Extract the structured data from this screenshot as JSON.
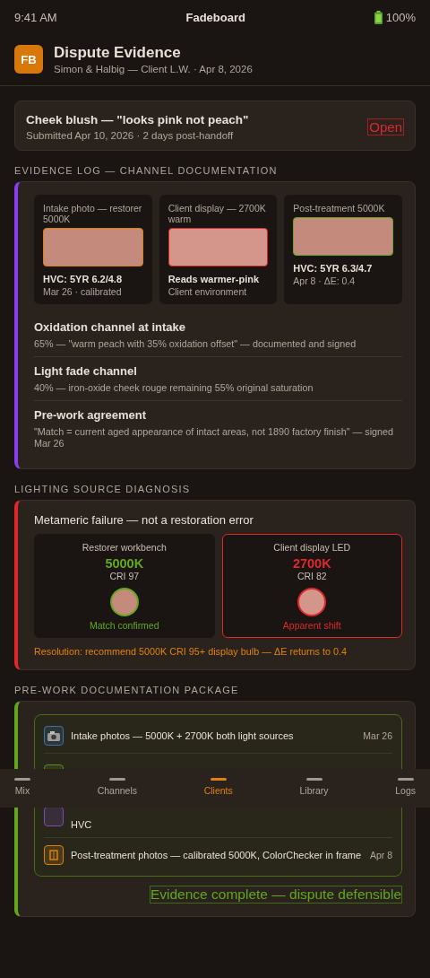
{
  "status_bar": {
    "time": "9:41 AM",
    "app": "Fadeboard",
    "battery": "100%"
  },
  "header": {
    "logo": "FB",
    "title": "Dispute Evidence",
    "subtitle": "Simon & Halbig — Client L.W. · Apr 8, 2026"
  },
  "dispute": {
    "title": "Cheek blush — \"looks pink not peach\"",
    "meta": "Submitted Apr 10, 2026 · 2 days post-handoff",
    "status": "Open"
  },
  "evidence": {
    "heading": "EVIDENCE LOG — CHANNEL DOCUMENTATION",
    "swatches": [
      {
        "label": "Intake photo — restorer 5000K",
        "color": "#c48a7c",
        "kind": "intake",
        "value": "HVC: 5YR 6.2/4.8",
        "note": "Mar 26 · calibrated"
      },
      {
        "label": "Client display — 2700K warm",
        "color": "#d4968a",
        "kind": "display",
        "value": "Reads warmer-pink",
        "note": "Client environment"
      },
      {
        "label": "Post-treatment 5000K",
        "color": "#c48a7c",
        "kind": "post",
        "value": "HVC: 5YR 6.3/4.7",
        "note": "Apr 8 · ΔE: 0.4"
      }
    ],
    "entries": [
      {
        "title": "Oxidation channel at intake",
        "text": "65% — \"warm peach with 35% oxidation offset\" — documented and signed"
      },
      {
        "title": "Light fade channel",
        "text": "40% — iron-oxide cheek rouge remaining 55% original saturation"
      },
      {
        "title": "Pre-work agreement",
        "text": "\"Match = current aged appearance of intact areas, not 1890 factory finish\" — signed Mar 26"
      }
    ]
  },
  "lighting": {
    "heading": "LIGHTING SOURCE DIAGNOSIS",
    "title": "Metameric failure — not a restoration error",
    "sources": [
      {
        "name": "Restorer workbench",
        "temp": "5000K",
        "cri": "CRI 97",
        "status": "Match confirmed",
        "kind": "ok",
        "color": "#c48a7c"
      },
      {
        "name": "Client display LED",
        "temp": "2700K",
        "cri": "CRI 82",
        "status": "Apparent shift",
        "kind": "fail",
        "color": "#d4968a"
      }
    ],
    "resolution": "Resolution: recommend 5000K CRI 95+ display bulb — ΔE returns to 0.4"
  },
  "package": {
    "heading": "PRE-WORK DOCUMENTATION PACKAGE",
    "items": [
      {
        "kind": "camera",
        "color": "#3d6fb0",
        "text": "Intake photos — 5000K + 2700K both light sources",
        "date": "Mar 26"
      },
      {
        "kind": "covered",
        "color": "#5c8a20"
      },
      {
        "kind": "covered",
        "color": "#7a4ab8",
        "text": "HVC"
      },
      {
        "kind": "frame",
        "color": "#d9820f",
        "text": "Post-treatment photos — calibrated 5000K, ColorChecker in frame",
        "date": "Apr 8"
      }
    ],
    "footer": "Evidence complete — dispute defensible"
  },
  "tabs": [
    {
      "label": "Mix",
      "selected": false
    },
    {
      "label": "Channels",
      "selected": false
    },
    {
      "label": "Clients",
      "selected": true
    },
    {
      "label": "Library",
      "selected": false
    },
    {
      "label": "Logs",
      "selected": false
    }
  ]
}
